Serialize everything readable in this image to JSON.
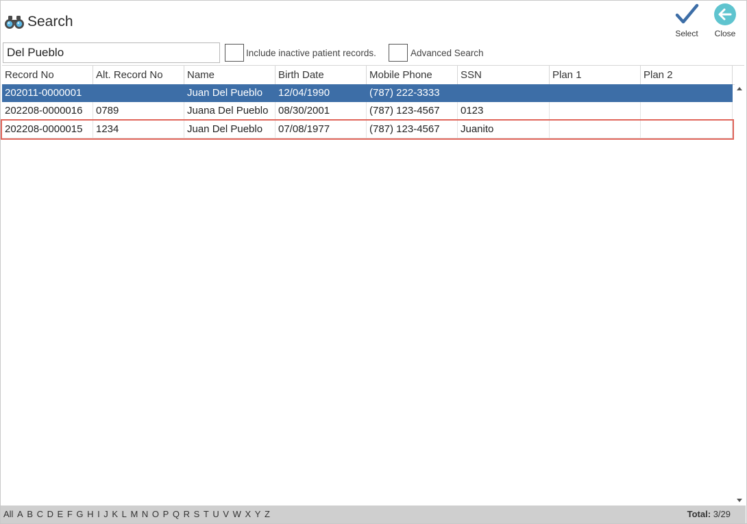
{
  "header": {
    "title": "Search",
    "title_icon": "binoculars-icon",
    "select_label": "Select",
    "close_label": "Close"
  },
  "search": {
    "value": "Del Pueblo",
    "include_inactive_label": "Include inactive patient records.",
    "include_inactive_checked": false,
    "advanced_label": "Advanced Search",
    "advanced_checked": false
  },
  "table": {
    "columns": [
      "Record No",
      "Alt. Record No",
      "Name",
      "Birth Date",
      "Mobile Phone",
      "SSN",
      "Plan 1",
      "Plan 2"
    ],
    "rows": [
      [
        "202011-0000001",
        "",
        "Juan Del Pueblo",
        "12/04/1990",
        "(787) 222-3333",
        "",
        "",
        ""
      ],
      [
        "202208-0000016",
        "0789",
        "Juana Del Pueblo",
        "08/30/2001",
        "(787) 123-4567",
        "0123",
        "",
        ""
      ],
      [
        "202208-0000015",
        "1234",
        "Juan Del Pueblo",
        "07/08/1977",
        "(787) 123-4567",
        "Juanito",
        "",
        ""
      ]
    ],
    "selected_row": 0,
    "outlined_row": 2
  },
  "footer": {
    "letters": [
      "All",
      "A",
      "B",
      "C",
      "D",
      "E",
      "F",
      "G",
      "H",
      "I",
      "J",
      "K",
      "L",
      "M",
      "N",
      "O",
      "P",
      "Q",
      "R",
      "S",
      "T",
      "U",
      "V",
      "W",
      "X",
      "Y",
      "Z"
    ],
    "total_label": "Total:",
    "total_value": "3/29"
  },
  "colors": {
    "selected_row": "#3d6ea7",
    "select_check": "#3d6ea7",
    "close_circle": "#5fc4cf",
    "outline": "#e0655a"
  }
}
